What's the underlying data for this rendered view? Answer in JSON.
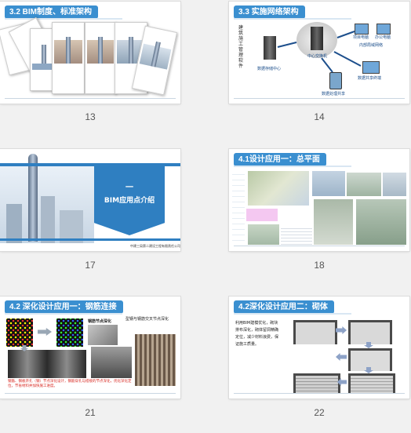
{
  "slides": [
    {
      "number": "13",
      "title": "3.2 BIM制度、标准架构"
    },
    {
      "number": "14",
      "title": "3.3 实施网络架构",
      "labels": {
        "vertical": "建筑施工管理软件",
        "server_left": "数据存储中心",
        "center": "中心交换机",
        "top_right_1": "项目电脑",
        "top_right_2": "办公电脑",
        "top_right_3": "内部局域网络",
        "right": "数据共享终端",
        "bottom": "数据处理共享"
      }
    },
    {
      "number": "17",
      "chapter_mark": "一",
      "chapter_title": "BIM应用点介绍",
      "footer": "中建三局第二建设工程有限责任公司"
    },
    {
      "number": "18",
      "title": "4.1设计应用一：总平面"
    },
    {
      "number": "21",
      "title": "4.2 深化设计应用一：钢筋连接",
      "center_label": "钢筋节点深化",
      "side_text": "型钢与钢筋交叉节点深化",
      "bottom_text": "钢筋、钢板开孔（钢）节点深化设计，钢筋穿孔与搭接的节点深化，优化深化定位，节省材料并加快施工进度。"
    },
    {
      "number": "22",
      "title": "4.2深化设计应用二：砌体",
      "side_text": "利用BIM建模优化，砌块排布深化，砌体留洞精确定位，减少材料浪费，保证施工质量。"
    }
  ],
  "colors": {
    "title_bar": "#3a8fd0",
    "chapter_blue": "#2f7fc1",
    "red_text": "#d8261f",
    "background": "#f1f1f1"
  }
}
